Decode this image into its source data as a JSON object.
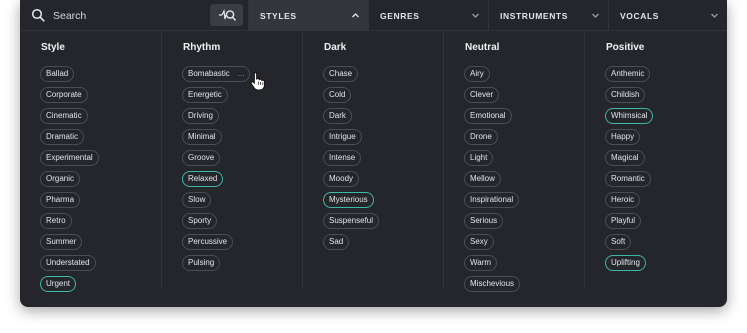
{
  "search": {
    "placeholder": "Search"
  },
  "tabs": [
    {
      "label": "STYLES",
      "active": true
    },
    {
      "label": "GENRES",
      "active": false
    },
    {
      "label": "INSTRUMENTS",
      "active": false
    },
    {
      "label": "VOCALS",
      "active": false
    }
  ],
  "columns": [
    {
      "title": "Style",
      "chips": [
        {
          "label": "Ballad"
        },
        {
          "label": "Corporate"
        },
        {
          "label": "Cinematic"
        },
        {
          "label": "Dramatic"
        },
        {
          "label": "Experimental"
        },
        {
          "label": "Organic"
        },
        {
          "label": "Pharma"
        },
        {
          "label": "Retro"
        },
        {
          "label": "Summer"
        },
        {
          "label": "Understated"
        },
        {
          "label": "Urgent",
          "selected": true
        }
      ]
    },
    {
      "title": "Rhythm",
      "chips": [
        {
          "label": "Bomabastic",
          "hover": true,
          "more": "..."
        },
        {
          "label": "Energetic"
        },
        {
          "label": "Driving"
        },
        {
          "label": "Minimal"
        },
        {
          "label": "Groove"
        },
        {
          "label": "Relaxed",
          "selected": true
        },
        {
          "label": "Slow"
        },
        {
          "label": "Sporty"
        },
        {
          "label": "Percussive"
        },
        {
          "label": "Pulsing"
        }
      ]
    },
    {
      "title": "Dark",
      "chips": [
        {
          "label": "Chase"
        },
        {
          "label": "Cold"
        },
        {
          "label": "Dark"
        },
        {
          "label": "Intrigue"
        },
        {
          "label": "Intense"
        },
        {
          "label": "Moody"
        },
        {
          "label": "Mysterious",
          "selected": true
        },
        {
          "label": "Suspenseful"
        },
        {
          "label": "Sad"
        }
      ]
    },
    {
      "title": "Neutral",
      "chips": [
        {
          "label": "Airy"
        },
        {
          "label": "Clever"
        },
        {
          "label": "Emotional"
        },
        {
          "label": "Drone"
        },
        {
          "label": "Light"
        },
        {
          "label": "Mellow"
        },
        {
          "label": "Inspirational"
        },
        {
          "label": "Serious"
        },
        {
          "label": "Sexy"
        },
        {
          "label": "Warm"
        },
        {
          "label": "Mischevious"
        }
      ]
    },
    {
      "title": "Positive",
      "chips": [
        {
          "label": "Anthemic"
        },
        {
          "label": "Childish"
        },
        {
          "label": "Whimsical",
          "selected": true
        },
        {
          "label": "Happy"
        },
        {
          "label": "Magical"
        },
        {
          "label": "Romantic"
        },
        {
          "label": "Heroic"
        },
        {
          "label": "Playful"
        },
        {
          "label": "Soft"
        },
        {
          "label": "Uplifting",
          "selected": true
        }
      ]
    }
  ],
  "colors": {
    "panel": "#24262b",
    "selected_border": "#3fb6a8",
    "chip_border": "#4a4d55"
  }
}
